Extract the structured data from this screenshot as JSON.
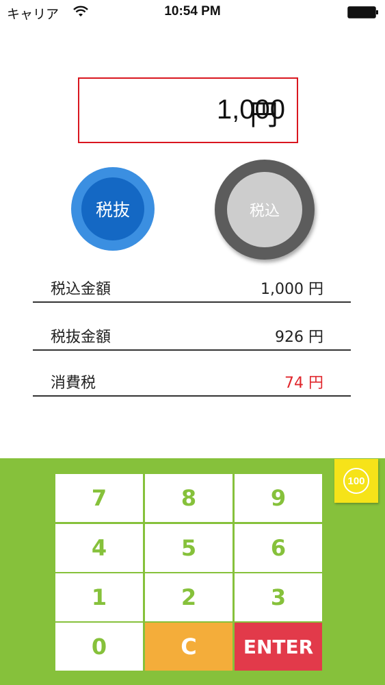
{
  "status_bar": {
    "carrier": "キャリア",
    "time": "10:54 PM"
  },
  "display": {
    "amount": "1,000",
    "unit": "円",
    "border_color": "#d9161f"
  },
  "modes": {
    "exclusive_label": "税抜",
    "inclusive_label": "税込"
  },
  "results": [
    {
      "label": "税込金額",
      "value": "1,000 円"
    },
    {
      "label": "税抜金額",
      "value": "926 円"
    },
    {
      "label": "消費税",
      "value": "74 円"
    }
  ],
  "keypad": {
    "keys": [
      "7",
      "8",
      "9",
      "4",
      "5",
      "6",
      "1",
      "2",
      "3",
      "0"
    ],
    "clear_label": "C",
    "enter_label": "ENTER",
    "hundred_label": "100"
  },
  "colors": {
    "keypad_bg": "#86c13b",
    "clear": "#f4ad3a",
    "enter": "#e23a4a",
    "hundred": "#f6e319",
    "tax_value": "#e0262c"
  }
}
